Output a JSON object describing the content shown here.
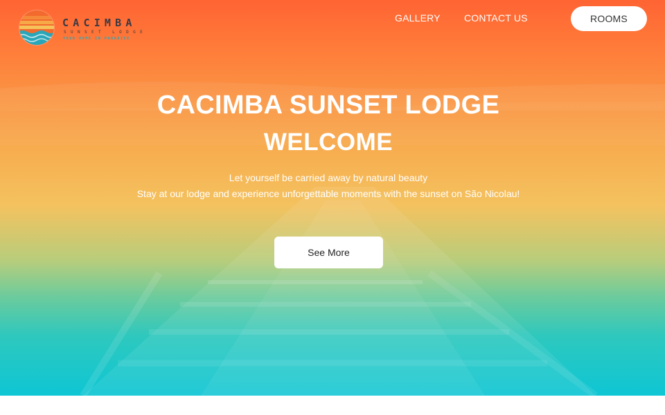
{
  "brand": {
    "name": "CACIMBA",
    "subtitle": "SUNSET LODGE",
    "tagline": "YOUR HOME IN PARADISE"
  },
  "nav": {
    "gallery": "GALLERY",
    "contact": "CONTACT US",
    "rooms": "ROOMS"
  },
  "hero": {
    "title": "CACIMBA SUNSET LODGE",
    "subtitle": "WELCOME",
    "tagline": "Let yourself be carried away by natural beauty",
    "description": "Stay at our lodge and experience unforgettable moments with the sunset on São Nicolau!",
    "cta": "See More"
  },
  "colors": {
    "gradient_top": "#ff6433",
    "gradient_mid": "#f4c25f",
    "gradient_bottom": "#0ec6d4",
    "logo_text": "#3a3a44",
    "logo_accent": "#2aa6b9"
  },
  "icons": {
    "logo": "sunset-waves-logo-icon"
  }
}
